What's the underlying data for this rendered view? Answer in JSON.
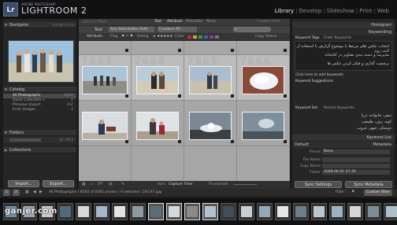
{
  "title_bar": {
    "logo_text": "Lr",
    "brand_small": "ADOBE PHOTOSHOP",
    "brand_big": "LIGHTROOM 2",
    "modules": [
      "Library",
      "Develop",
      "Slideshow",
      "Print",
      "Web"
    ],
    "active_module": "Library"
  },
  "left_panel": {
    "navigator_label": "Navigator",
    "navigator_options": "FIT  FILL  1:1  3:1",
    "catalog_label": "Catalog",
    "catalog_items": [
      {
        "label": "All Photographs",
        "count": "8392"
      },
      {
        "label": "Quick Collection +",
        "count": "0"
      },
      {
        "label": "Previous Import",
        "count": "392"
      },
      {
        "label": "Error Images",
        "count": "4"
      }
    ],
    "folders_label": "Folders",
    "folder_count": "12 / 66.0",
    "collections_label": "Collections",
    "import_button": "Import...",
    "export_button": "Export..."
  },
  "filter_bar": {
    "label": "Library Filter :",
    "tabs": [
      "Text",
      "Attribute",
      "Metadata",
      "None"
    ],
    "active_tabs": [
      "Text",
      "Attribute"
    ],
    "preset": "Custom Filter"
  },
  "text_filter": {
    "label": "Text",
    "field1": "Any Searchable Field",
    "field2": "Contains All"
  },
  "attribute_filter": {
    "label": "Attribute",
    "flag_label": "Flag",
    "rating_label": "Rating",
    "color_label": "Color",
    "copy_status_label": "Copy Status",
    "colors": [
      "#b23030",
      "#c9a72c",
      "#3a9a3a",
      "#3b62b4",
      "#8a3ba6",
      "#777777"
    ]
  },
  "grid": {
    "cell_numbers": [
      "7663",
      "7664",
      "7665",
      "7666"
    ]
  },
  "toolbar": {
    "sort_label": "Sort:",
    "sort_value": "Capture Time",
    "thumbnails_label": "Thumbnails"
  },
  "right_panel": {
    "histogram_label": "Histogram",
    "keywording_label": "Keywording",
    "keyword_tags_label": "Keyword Tags",
    "keyword_tags_value": "Enter Keywords",
    "keyword_text_lines": [
      "انتخاب عکس های مرتبط با موضوع گزارش با استفاده از لایت روم",
      "مدیریت و دسته بندی تصاویر در کتابخانه",
      "برچسب گذاری و فیلتر کردن عکس ها"
    ],
    "click_hint": "Click here to add keywords",
    "suggestions_label": "Keyword Suggestions",
    "keyword_set_label": "Keyword Set",
    "keyword_set_value": "Recent Keywords",
    "recent_keywords": [
      "سفر، خانواده، دریا",
      "کوه، برف، طبیعت",
      "دوستان، شهر، غروب"
    ],
    "keyword_list_label": "Keyword List",
    "metadata_label": "Metadata",
    "metadata_preset_select": "Default",
    "preset_label": "Preset",
    "preset_value": "None",
    "file_name_label": "File Name",
    "copy_name_label": "Copy Name",
    "folder_label": "Folder",
    "folder_value": "2008-06-01 07:30",
    "sync_settings_button": "Sync Settings",
    "sync_metadata_button": "Sync Metadata"
  },
  "bottom_bar": {
    "page_numbers": [
      "1",
      "2"
    ],
    "status": "All Photographs / 8183 of 8392 photos / 4 selected / 193.67.jpg",
    "filter_label": "Filter :",
    "custom_filter": "Custom Filter"
  },
  "filmstrip": {
    "watermark": "ganjer.com",
    "frame_colors": [
      "#6e90a8",
      "#9aa6b5",
      "#c9c9c9",
      "#4f6a7d",
      "#d8d8d8",
      "#a4b7c8",
      "#e3e3e3",
      "#8c9aa4",
      "#5a6f7a",
      "#d2d8de",
      "#8a8a8a",
      "#b1c2d0",
      "#3e4e5a",
      "#c7cfd6",
      "#96a9b8",
      "#e6e6e6",
      "#6a7f8c",
      "#b9c6cf",
      "#9ab3c5",
      "#d6d6d6",
      "#7b8d97",
      "#aebfcc"
    ]
  }
}
